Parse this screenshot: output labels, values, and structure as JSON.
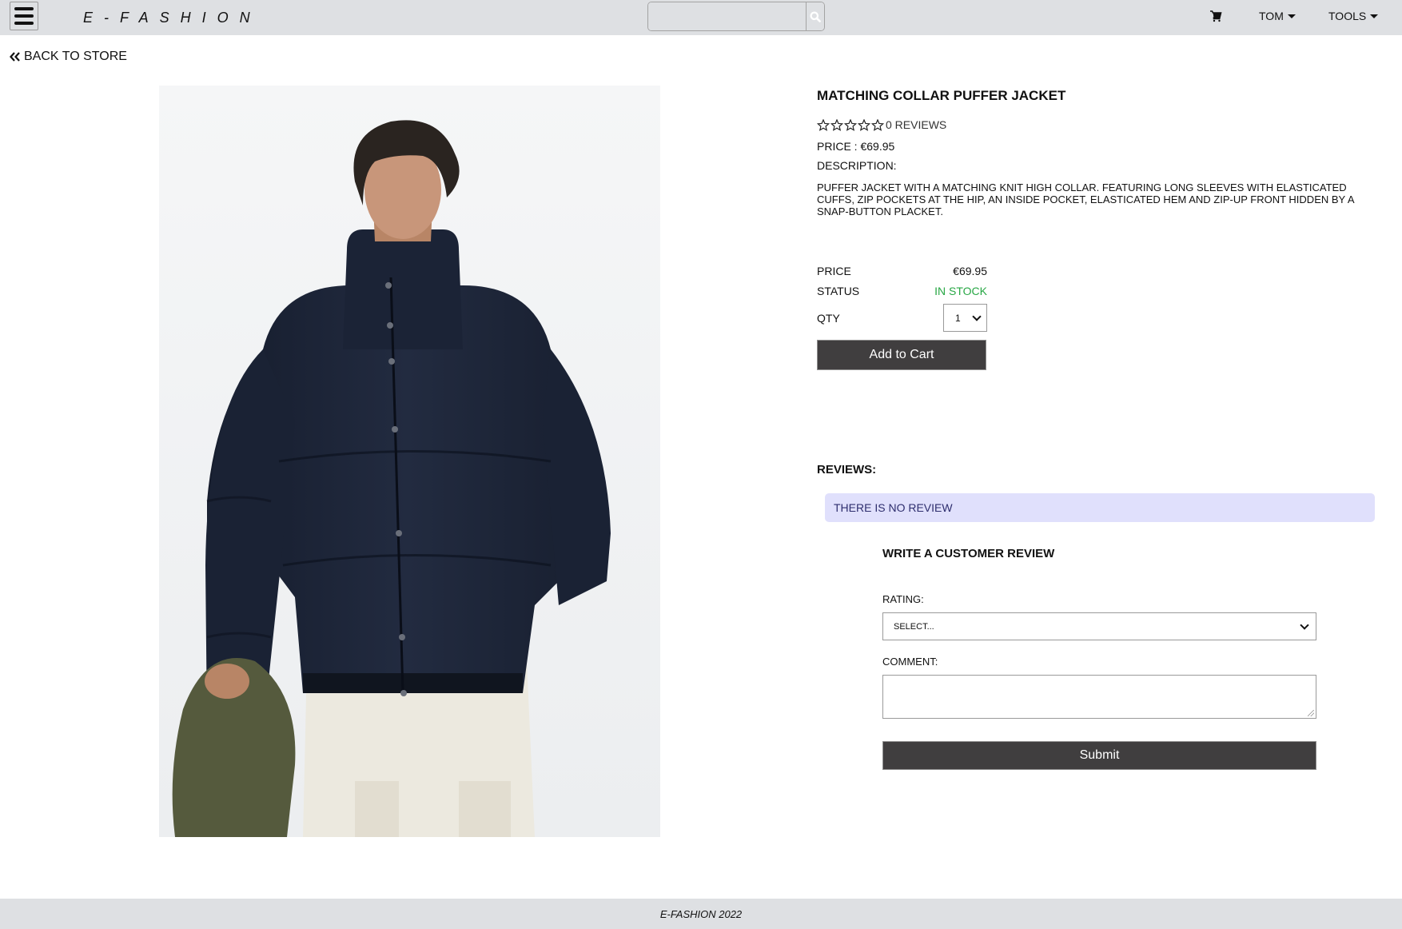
{
  "navbar": {
    "menu_icon": "hamburger-icon",
    "logo": "E-FASHION",
    "search": {
      "value": "",
      "placeholder": "",
      "icon": "search-icon"
    },
    "cart_icon": "cart-icon",
    "user_menu": "TOM",
    "tools_menu": "TOOLS"
  },
  "back_link": {
    "icon": "double-chevron-left-icon",
    "label": "BACK TO STORE"
  },
  "product": {
    "image_alt": "Model wearing navy matching collar puffer jacket with white cargo trousers, holding an olive fleece jacket",
    "title": "MATCHING COLLAR PUFFER JACKET",
    "rating": {
      "stars_filled": 0,
      "stars_total": 5,
      "reviews_label": "0 REVIEWS"
    },
    "price_line": "PRICE : €69.95",
    "description_label": "DESCRIPTION:",
    "description": "PUFFER JACKET WITH A MATCHING KNIT HIGH COLLAR. FEATURING LONG SLEEVES WITH ELASTICATED CUFFS, ZIP POCKETS AT THE HIP, AN INSIDE POCKET, ELASTICATED HEM AND ZIP-UP FRONT HIDDEN BY A SNAP-BUTTON PLACKET."
  },
  "purchase": {
    "price_label": "PRICE",
    "price_value": "€69.95",
    "status_label": "STATUS",
    "status_value": "IN STOCK",
    "status_color": "#28a745",
    "qty_label": "QTY",
    "qty_value": "1",
    "add_to_cart": "Add to Cart"
  },
  "reviews": {
    "heading": "REVIEWS:",
    "empty_message": "THERE IS NO REVIEW",
    "form": {
      "title": "WRITE A CUSTOMER REVIEW",
      "rating_label": "RATING:",
      "rating_value": "SELECT...",
      "comment_label": "COMMENT:",
      "comment_value": "",
      "submit": "Submit"
    }
  },
  "footer": {
    "text": "E-FASHION 2022"
  },
  "colors": {
    "navbar_bg": "#dee0e3",
    "button_bg": "#403e3f",
    "alert_bg": "#e0e0fc",
    "alert_text": "#2e2e6e",
    "in_stock": "#28a745"
  }
}
